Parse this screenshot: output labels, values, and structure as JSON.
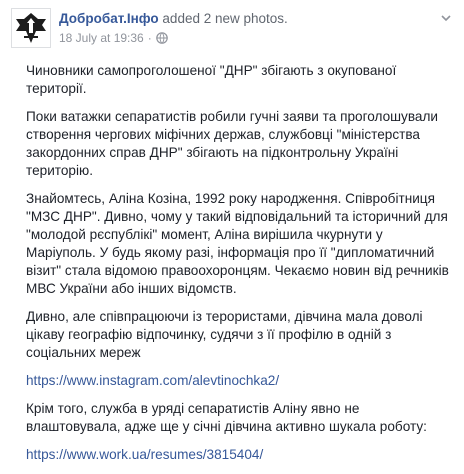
{
  "post": {
    "author": "Добробат.Інфо",
    "action": " added 2 new photos.",
    "date": "18 July at 19:36",
    "separator": "·"
  },
  "body": {
    "p1": "Чиновники самопроголошеної \"ДНР\" збігають з окупованої території.",
    "p2": "Поки ватажки сепаратистів робили гучні заяви та проголошували створення чергових міфічних держав, службовці \"міністерства закордонних справ ДНР\" збігають на підконтрольну Україні територію.",
    "p3": "Знайомтесь, Аліна Козіна, 1992 року народження. Співробітниця \"МЗС ДНР\". Дивно, чому у такий відповідальний та історичний для \"молодой рєспублікі\" момент, Аліна вирішила чкурнути у Маріуполь. У будь якому разі, інформація про її \"дипломатичний візит\" стала відомою правоохоронцям. Чекаємо новин від речників МВС України або інших відомств.",
    "p4": "Дивно, але співпрацюючи із терористами, дівчина мала доволі цікаву географію відпочинку, судячи з її профілю в одній з соціальних мереж",
    "link1": "https://www.instagram.com/alevtinochka2/",
    "p5": "Крім того, служба в уряді сепаратистів Аліну явно не влаштовувала, адже ще у січні дівчина активно шукала роботу:",
    "link2": "https://www.work.ua/resumes/3815404/"
  },
  "icons": {
    "avatar": "dobrobat-logo",
    "privacy": "globe-icon",
    "menu": "chevron-down-icon"
  },
  "colors": {
    "link": "#365899",
    "text": "#1d2129",
    "meta": "#90949c"
  }
}
